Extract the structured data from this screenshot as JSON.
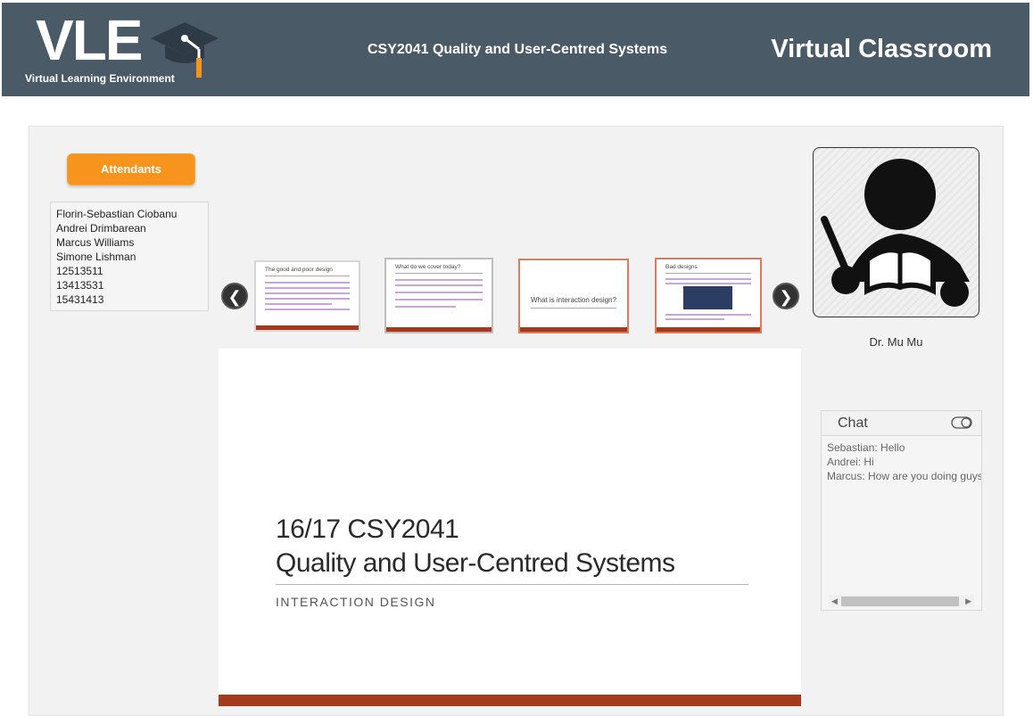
{
  "header": {
    "logo": "VLE",
    "logo_subtitle": "Virtual Learning Environment",
    "course_title": "CSY2041 Quality and User-Centred Systems",
    "page_title": "Virtual Classroom"
  },
  "attendants": {
    "button_label": "Attendants",
    "list": [
      "Florin-Sebastian Ciobanu",
      "Andrei Drimbarean",
      "Marcus Williams",
      "Simone Lishman",
      "12513511",
      "13413531",
      "15431413"
    ]
  },
  "slides": {
    "thumbnails": [
      {
        "title": "The good and poor design"
      },
      {
        "title": "What do we cover today?"
      },
      {
        "title": "What is interaction design?"
      },
      {
        "title": "Bad designs"
      }
    ],
    "current": {
      "title_line1": "16/17 CSY2041",
      "title_line2": "Quality and User-Centred Systems",
      "subtitle": "INTERACTION DESIGN"
    }
  },
  "presenter": {
    "name": "Dr. Mu Mu"
  },
  "chat": {
    "title": "Chat",
    "messages": [
      "Sebastian: Hello",
      "Andrei: Hi",
      "Marcus: How are you doing guys"
    ]
  },
  "colors": {
    "header_bg": "#4a5a67",
    "accent_orange": "#f7941d",
    "slide_bar": "#a33a1e"
  }
}
